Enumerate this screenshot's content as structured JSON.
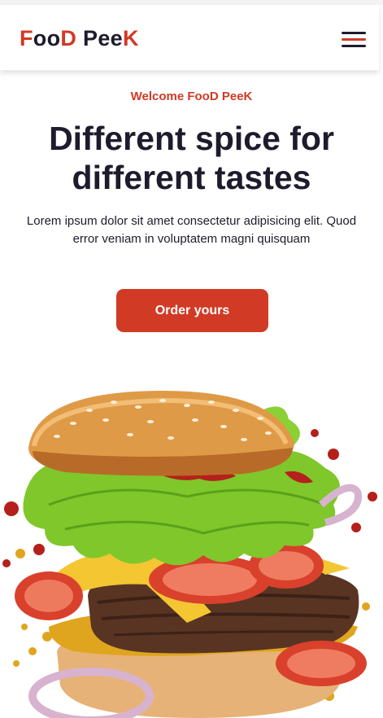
{
  "header": {
    "logo": {
      "parts": [
        "F",
        "oo",
        "D",
        " Pee",
        "K"
      ]
    },
    "menu_icon": "hamburger-icon"
  },
  "hero": {
    "welcome": "Welcome FooD PeeK",
    "title": "Different spice for different tastes",
    "description": "Lorem ipsum dolor sit amet consectetur adipisicing elit. Quod error veniam in voluptatem magni quisquam",
    "cta_label": "Order yours"
  },
  "colors": {
    "accent": "#d13a24",
    "text": "#1d1b2c",
    "background": "#ffffff"
  }
}
